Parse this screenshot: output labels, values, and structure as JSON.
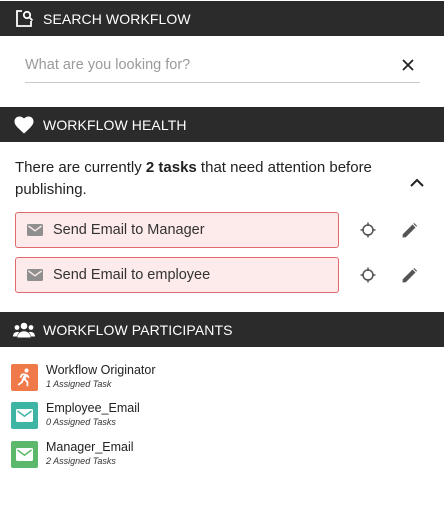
{
  "search": {
    "title": "SEARCH WORKFLOW",
    "icon": "search-document-icon",
    "placeholder": "What are you looking for?",
    "value": "",
    "clear_icon": "close-icon"
  },
  "health": {
    "title": "WORKFLOW HEALTH",
    "icon": "heart-icon",
    "message_prefix": "There are currently ",
    "message_count": "2 tasks",
    "message_suffix": " that need attention before publishing.",
    "collapse_icon": "chevron-up-icon",
    "tasks": [
      {
        "label": "Send Email to Manager",
        "icon": "mail-icon"
      },
      {
        "label": "Send Email to employee",
        "icon": "mail-icon"
      }
    ],
    "colors": {
      "task_bg": "#fdeaea",
      "task_border": "#e0696b"
    }
  },
  "participants": {
    "title": "WORKFLOW PARTICIPANTS",
    "icon": "people-icon",
    "items": [
      {
        "name": "Workflow Originator",
        "count": "1 Assigned Task",
        "icon": "runner-icon",
        "color": "#f0794a"
      },
      {
        "name": "Employee_Email",
        "count": "0 Assigned Tasks",
        "icon": "mail-icon",
        "color": "#3eb4a5"
      },
      {
        "name": "Manager_Email",
        "count": "2 Assigned Tasks",
        "icon": "mail-icon",
        "color": "#5cb86a"
      }
    ]
  },
  "colors": {
    "header_bg": "#2b2b2b",
    "header_text": "#ffffff"
  }
}
